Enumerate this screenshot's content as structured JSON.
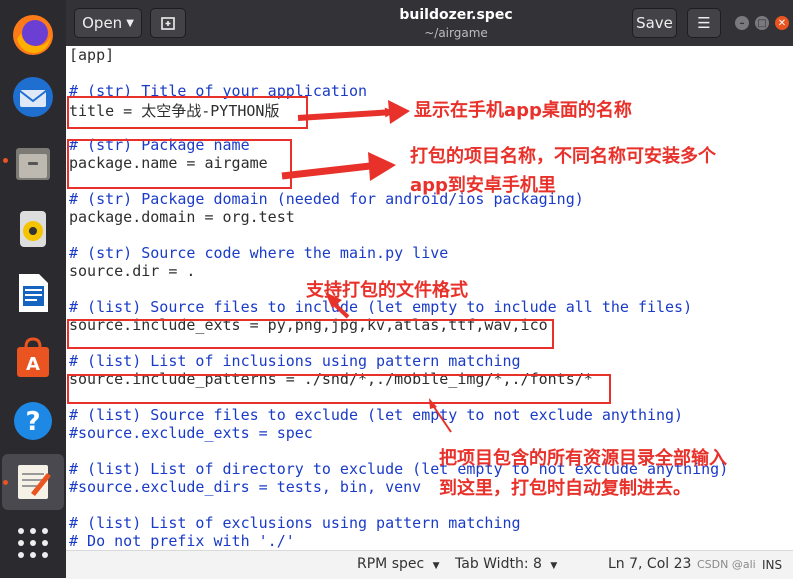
{
  "window": {
    "open_label": "Open",
    "title": "buildozer.spec",
    "subtitle": "~/airgame",
    "save_label": "Save"
  },
  "dock": {
    "items": [
      "firefox-icon",
      "thunderbird-icon",
      "files-icon",
      "rhythmbox-icon",
      "libreoffice-writer-icon",
      "software-center-icon",
      "help-icon",
      "text-editor-icon",
      "apps-grid-icon"
    ]
  },
  "editor": {
    "lines": [
      {
        "text": "[app]",
        "type": "plain"
      },
      {
        "text": "",
        "type": "plain"
      },
      {
        "text": "# (str) Title of your application",
        "type": "comment"
      },
      {
        "text": "title = 太空争战-PYTHON版",
        "type": "plain"
      },
      {
        "text": "",
        "type": "plain"
      },
      {
        "text": "# (str) Package name",
        "type": "comment"
      },
      {
        "text": "package.name = airgame",
        "type": "plain"
      },
      {
        "text": "",
        "type": "plain"
      },
      {
        "text": "# (str) Package domain (needed for android/ios packaging)",
        "type": "comment"
      },
      {
        "text": "package.domain = org.test",
        "type": "plain"
      },
      {
        "text": "",
        "type": "plain"
      },
      {
        "text": "# (str) Source code where the main.py live",
        "type": "comment"
      },
      {
        "text": "source.dir = .",
        "type": "plain"
      },
      {
        "text": "",
        "type": "plain"
      },
      {
        "text": "# (list) Source files to include (let empty to include all the files)",
        "type": "comment"
      },
      {
        "text": "source.include_exts = py,png,jpg,kv,atlas,ttf,wav,ico",
        "type": "plain"
      },
      {
        "text": "",
        "type": "plain"
      },
      {
        "text": "# (list) List of inclusions using pattern matching",
        "type": "comment"
      },
      {
        "text": "source.include_patterns = ./snd/*,./mobile_img/*,./fonts/*",
        "type": "plain"
      },
      {
        "text": "",
        "type": "plain"
      },
      {
        "text": "# (list) Source files to exclude (let empty to not exclude anything)",
        "type": "comment"
      },
      {
        "text": "#source.exclude_exts = spec",
        "type": "comment"
      },
      {
        "text": "",
        "type": "plain"
      },
      {
        "text": "# (list) List of directory to exclude (let empty to not exclude anything)",
        "type": "comment"
      },
      {
        "text": "#source.exclude_dirs = tests, bin, venv",
        "type": "comment"
      },
      {
        "text": "",
        "type": "plain"
      },
      {
        "text": "# (list) List of exclusions using pattern matching",
        "type": "comment"
      },
      {
        "text": "# Do not prefix with './'",
        "type": "comment"
      }
    ]
  },
  "status": {
    "language": "RPM spec",
    "tab_width": "Tab Width: 8",
    "position": "Ln 7, Col 23",
    "mode": "INS",
    "watermark": "CSDN @ali"
  },
  "annotations": {
    "title_note": "显示在手机app桌面的名称",
    "package_note_1": "打包的项目名称，不同名称可安装多个",
    "package_note_2": "app到安卓手机里",
    "formats_note": "支持打包的文件格式",
    "resources_note_1": "把项目包含的所有资源目录全部输入",
    "resources_note_2": "到这里，打包时自动复制进去。"
  },
  "colors": {
    "annotation": "#e8312a",
    "comment": "#1a3bc8",
    "dock": "#2b2a2e",
    "header": "#333237"
  }
}
